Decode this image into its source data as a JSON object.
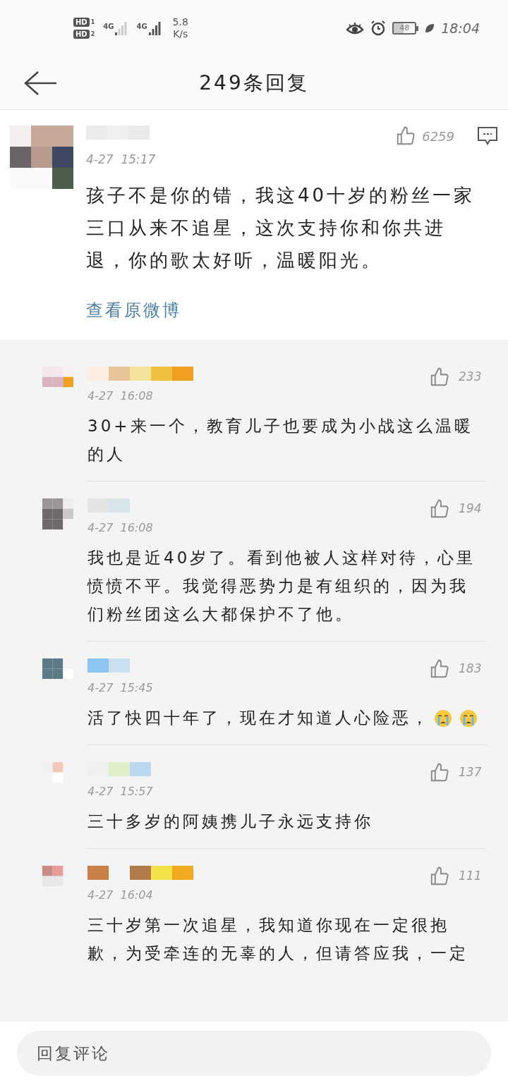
{
  "status_bar": {
    "sims": [
      {
        "badge": "HD",
        "slot": "1",
        "network": "4G"
      },
      {
        "badge": "HD",
        "slot": "2",
        "network": "4G"
      }
    ],
    "speed": "5.8",
    "speed_unit": "K/s",
    "battery": "48",
    "time": "18:04"
  },
  "header": {
    "title": "249条回复"
  },
  "post": {
    "date": "4-27  15:17",
    "likes": "6259",
    "text": "孩子不是你的错，我这40十岁的粉丝一家三口从来不追星，这次支持你和你共进退，你的歌太好听，温暖阳光。",
    "link": "查看原微博"
  },
  "replies": [
    {
      "date": "4-27  16:08",
      "likes": "233",
      "text": "30+来一个，教育儿子也要成为小战这么温暖的人"
    },
    {
      "date": "4-27  16:08",
      "likes": "194",
      "text": "我也是近40岁了。看到他被人这样对待，心里愤愤不平。我觉得恶势力是有组织的，因为我们粉丝团这么大都保护不了他。"
    },
    {
      "date": "4-27  15:45",
      "likes": "183",
      "text": "活了快四十年了，现在才知道人心险恶，",
      "emojis": [
        {
          "kind": "crying"
        },
        {
          "kind": "crying"
        }
      ]
    },
    {
      "date": "4-27  15:57",
      "likes": "137",
      "text": "三十多岁的阿姨携儿子永远支持你"
    },
    {
      "date": "4-27  16:04",
      "likes": "111",
      "text": "三十岁第一次追星，我知道你现在一定很抱歉，为受牵连的无辜的人，但请答应我，一定"
    }
  ],
  "reply_bar": {
    "placeholder": "回复评论"
  }
}
